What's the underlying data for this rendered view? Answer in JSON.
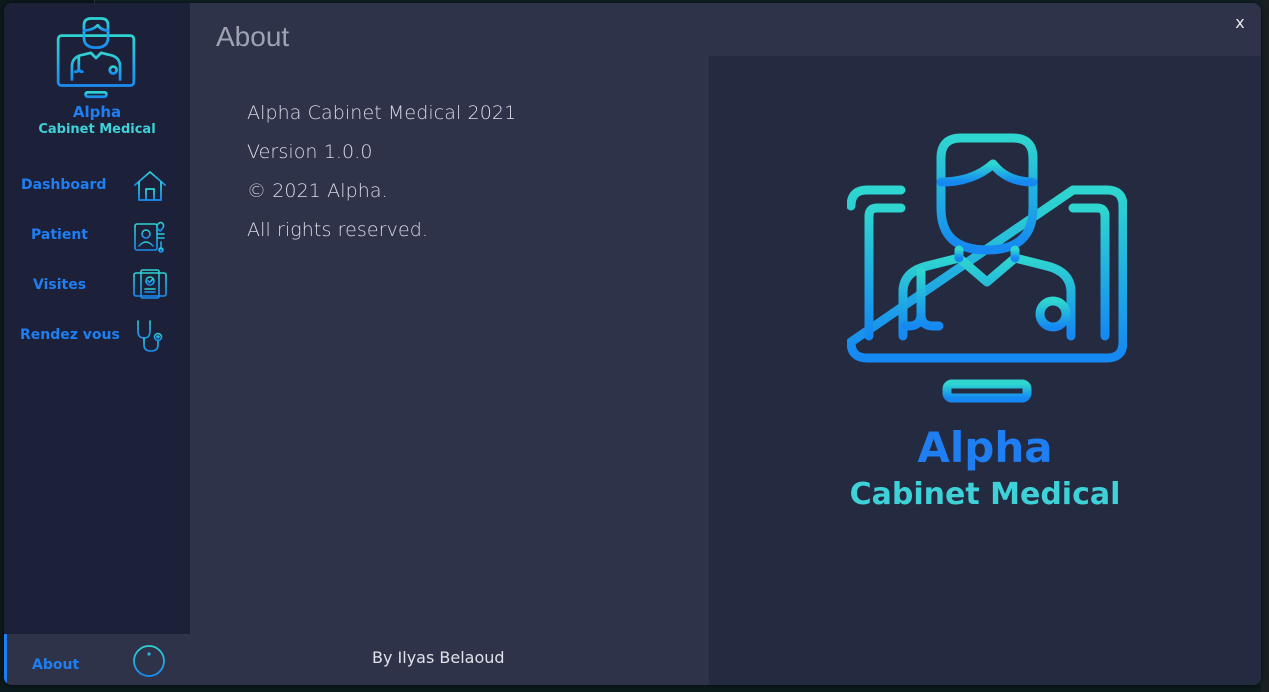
{
  "app": {
    "brand_name": "Alpha",
    "brand_subtitle": "Cabinet Medical"
  },
  "sidebar": {
    "items": [
      {
        "label": "Dashboard",
        "icon": "home-icon"
      },
      {
        "label": "Patient",
        "icon": "patient-icon"
      },
      {
        "label": "Visites",
        "icon": "clipboard-monitor-icon"
      },
      {
        "label": "Rendez vous",
        "icon": "stethoscope-icon"
      }
    ],
    "active": {
      "label": "About",
      "icon": "info-icon"
    }
  },
  "page": {
    "title": "About",
    "close_label": "x",
    "info_lines": [
      "Alpha Cabinet Medical 2021",
      "Version 1.0.0",
      "© 2021 Alpha.",
      "All rights reserved."
    ],
    "byline": "By  Ilyas Belaoud"
  },
  "colors": {
    "accent_blue": "#1e7ef2",
    "accent_cyan": "#3ed2d8",
    "sidebar_bg": "#1c2139",
    "content_bg": "#2f3349",
    "panel_bg": "#242a40"
  }
}
